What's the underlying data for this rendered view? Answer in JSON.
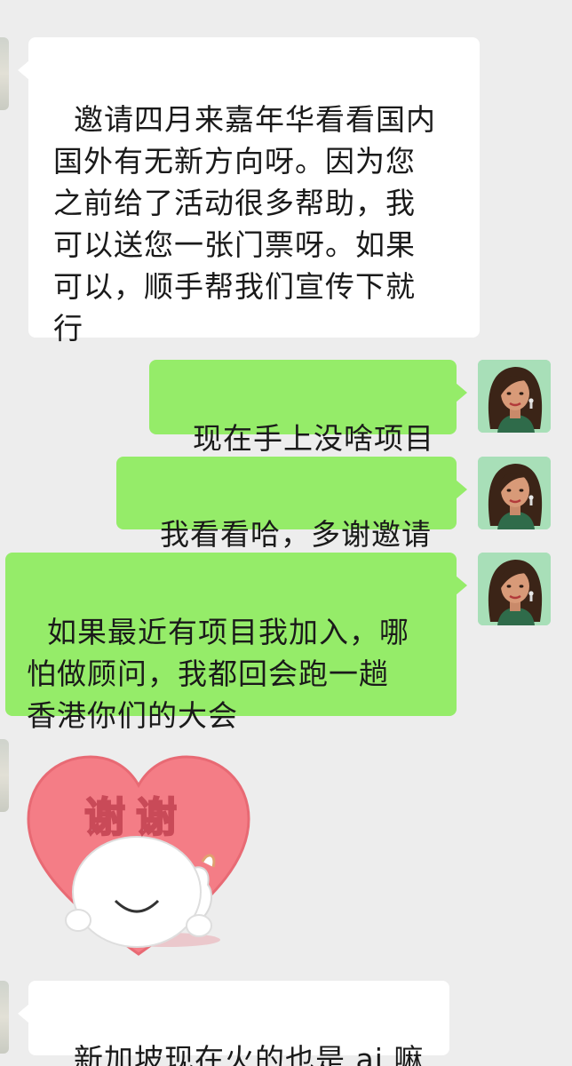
{
  "messages": [
    {
      "side": "in",
      "text": "邀请四月来嘉年华看看国内\n国外有无新方向呀。因为您\n之前给了活动很多帮助，我\n可以送您一张门票呀。如果\n可以，顺手帮我们宣传下就\n行"
    },
    {
      "side": "out",
      "text": "现在手上没啥项目"
    },
    {
      "side": "out",
      "text": "我看看哈，多谢邀请"
    },
    {
      "side": "out",
      "text": "如果最近有项目我加入，哪\n怕做顾问，我都回会跑一趟\n香港你们的大会"
    },
    {
      "side": "in",
      "sticker_text": "谢谢",
      "sticker": "heart-thanks-sticker"
    },
    {
      "side": "in",
      "text": "新加坡现在火的也是 ai 嘛"
    }
  ],
  "colors": {
    "background": "#ededed",
    "incoming_bubble": "#ffffff",
    "outgoing_bubble": "#95ec69",
    "sticker_heart": "#f47d86"
  }
}
